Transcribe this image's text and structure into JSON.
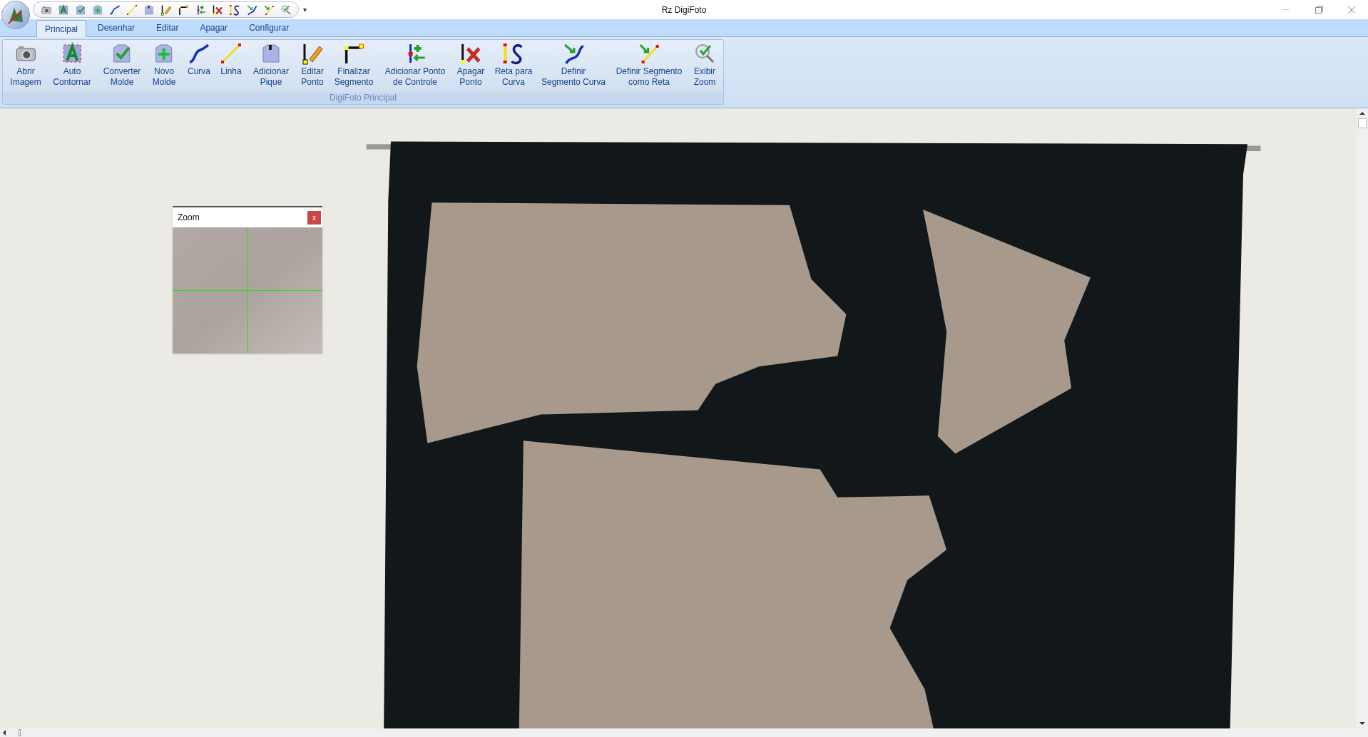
{
  "window": {
    "title": "Rz DigiFoto"
  },
  "quick_access_menu": "▾",
  "tabs": [
    {
      "label": "Principal",
      "selected": true
    },
    {
      "label": "Desenhar",
      "selected": false
    },
    {
      "label": "Editar",
      "selected": false
    },
    {
      "label": "Apagar",
      "selected": false
    },
    {
      "label": "Configurar",
      "selected": false
    }
  ],
  "ribbon": {
    "group_label": "DigiFoto Principal",
    "buttons": [
      {
        "lines": [
          "Abrir",
          "Imagem"
        ]
      },
      {
        "lines": [
          "Auto",
          "Contornar"
        ]
      },
      {
        "lines": [
          "Converter",
          "Molde"
        ]
      },
      {
        "lines": [
          "Novo",
          "Molde"
        ]
      },
      {
        "lines": [
          "Curva"
        ]
      },
      {
        "lines": [
          "Linha"
        ]
      },
      {
        "lines": [
          "Adicionar",
          "Pique"
        ]
      },
      {
        "lines": [
          "Editar",
          "Ponto"
        ]
      },
      {
        "lines": [
          "Finalizar",
          "Segmento"
        ]
      },
      {
        "lines": [
          "Adicionar Ponto",
          "de Controle"
        ]
      },
      {
        "lines": [
          "Apagar",
          "Ponto"
        ]
      },
      {
        "lines": [
          "Reta para",
          "Curva"
        ]
      },
      {
        "lines": [
          "Definir",
          "Segmento Curva"
        ]
      },
      {
        "lines": [
          "Definir Segmento",
          "como Reta"
        ]
      },
      {
        "lines": [
          "Exibir",
          "Zoom"
        ]
      }
    ]
  },
  "zoom_panel": {
    "title": "Zoom",
    "close": "x"
  }
}
